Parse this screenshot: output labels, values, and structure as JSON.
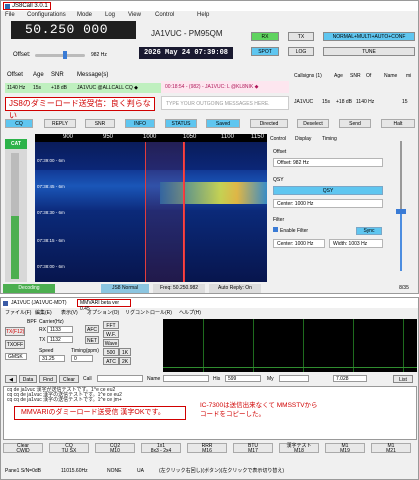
{
  "js8": {
    "title": "JS8Call 3.0.1",
    "menu": [
      "File",
      "Configurations",
      "Mode",
      "Log",
      "View",
      "Control",
      "Help"
    ],
    "frequency": "50.250 000",
    "callsign_grid": "JA1VUC - PM95QM",
    "datetime": "2026 May 24 07:39:08",
    "offset_label": "Offset:",
    "offset_value": "982 Hz",
    "offset_level": 0.55,
    "buttons": {
      "rx": "RX",
      "tx": "TX",
      "mode": "NORMAL+MULTI+AUTO+CONF",
      "spot": "SPOT",
      "log": "LOG",
      "tune": "TUNE"
    },
    "band_header": [
      "Offset",
      "Age",
      "SNR",
      "Message(s)"
    ],
    "band_row": {
      "offset": "1140 Hz",
      "age": "15s",
      "snr": "+18 dB",
      "message": "JA1VUC @ALLCALL CQ ◆"
    },
    "band_row_right": "00:18:54 - (982) - JA1VUC: L @KL8NIK ◆",
    "composer_placeholder": "TYPE YOUR OUTGOING MESSAGES HERE.",
    "annotation": "JS8のダミーロード送受信：良く判らない",
    "callsigns_header": [
      "Callsigns (1)",
      "Age",
      "SNR",
      "Of",
      "Name",
      "mi"
    ],
    "callsign_row": {
      "call": "JA1VUC",
      "age": "15s",
      "snr": "+18 dB",
      "offset": "1140 Hz",
      "num": "15"
    },
    "controls": [
      "CQ",
      "REPLY",
      "SNR",
      "INFO",
      "STATUS",
      "Saved",
      "Directed",
      "Deselect",
      "Send",
      "Halt"
    ],
    "cat": "CAT",
    "ruler_ticks": [
      "900",
      "950",
      "1000",
      "1050",
      "1100",
      "1150"
    ],
    "wf_stamps": [
      "07:39:00 - 6m",
      "07:38:45 - 6m",
      "07:38:30 - 6m",
      "07:38:15 - 6m",
      "07:38:00 - 6m"
    ],
    "tabs": [
      "Control",
      "Display",
      "Timing"
    ],
    "offset_section": "Offset",
    "offset_field": "Offset: 982 Hz",
    "qsy_section": "QSY",
    "qsy_button": "QSY",
    "center_field": "Center: 1000 Hz",
    "filter_section": "Filter",
    "enable_filter": "Enable Filter",
    "sync_button": "Sync",
    "filter_center": "Center: 1000 Hz",
    "filter_width": "Width: 1003 Hz",
    "meter_level": 0.5,
    "status": {
      "decoding": "Decoding",
      "tx_label": "JS8 Normal",
      "freq": "Freq: 50.250.982",
      "auto": "Auto Reply: On",
      "page": "8/35"
    }
  },
  "mm": {
    "title": "JA1VUC (JA1VUC-MDT)",
    "version": "MMVARI beta ver 0.45",
    "menu": [
      "ファイル(F)",
      "編集(E)",
      "表示(V)",
      "オプション(O)",
      "リグコントロール(R)",
      "ヘルプ(H)"
    ],
    "bpf": "BPF",
    "tx_f12": "TX(F12)",
    "txoff": "TXOFF",
    "carrier_label": "Carrier(Hz)",
    "rx_label": "RX",
    "rx_value": "1133",
    "tx_label": "TX",
    "tx_value": "1132",
    "afc": "AFC",
    "net": "NET",
    "fft": "FFT",
    "wf": "W.F.",
    "wave": "Wave",
    "mode_select": "GMSK",
    "speed_label": "Speed",
    "speed_value": "31.25",
    "timing_label": "Timing(ppm)",
    "timing_value": "0",
    "scale_500": "500",
    "scale_1k": "1K",
    "atc": "ATC",
    "scale_2k": "2K",
    "call_row": [
      "Data",
      "Find",
      "Clear",
      "Call",
      "Name",
      "His",
      "My",
      "List"
    ],
    "his_value": "599",
    "my_value": "",
    "clock_value": "7.028",
    "rx_lines": [
      "cq de ja1vuc 漢字が送信テストです。1^e ce eu2",
      "cq cq de ja1vuc 漢字の送信テストです。1^e ce eu2",
      "cq cq de ja1vuc 漢字の送信テストです。1^e ce jm+"
    ],
    "annotation1": "MMVARIのダミーロード送受信 漢字OKです。",
    "annotation2": "IC-7300は送信出来なくて MMSSTVからコードをコピーした。",
    "macros": [
      {
        "label": "Clear",
        "key": "CWID"
      },
      {
        "label": "CQ",
        "key": "TU SX"
      },
      {
        "label": "CQ2",
        "key": "M10"
      },
      {
        "label": "1x1",
        "key": "8x3 - 2x4"
      },
      {
        "label": "RRR",
        "key": "M16"
      },
      {
        "label": "BTU",
        "key": "M17"
      },
      {
        "label": "漢字テスト",
        "key": "M18"
      },
      {
        "label": "M1",
        "key": "M19"
      },
      {
        "label": "M1",
        "key": "M21"
      }
    ],
    "status": [
      "Pane1 S/N=0dB",
      "11015.60Hz",
      "NONE",
      "UA",
      "(左クリック右回し)(ボタン)(左クリックで表示切り替え)"
    ]
  }
}
